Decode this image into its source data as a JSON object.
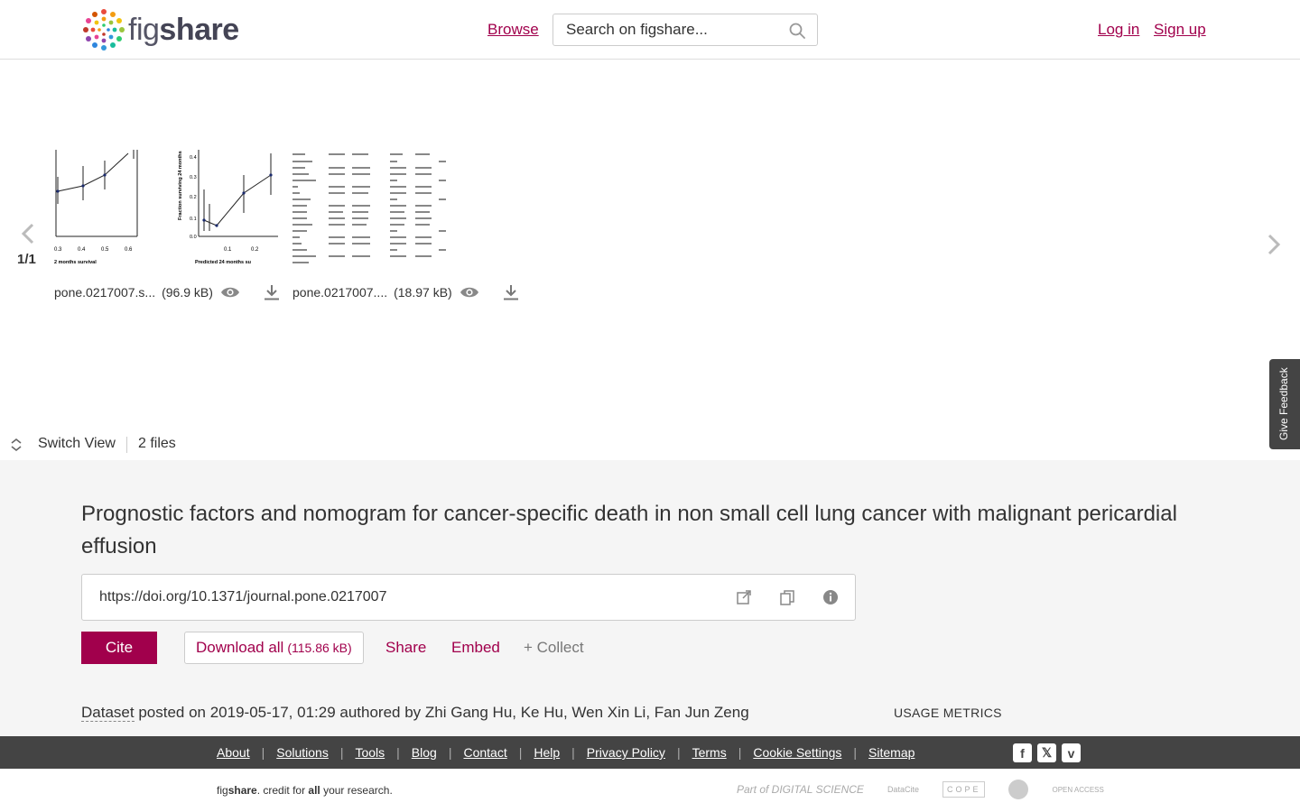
{
  "header": {
    "brand_light": "fig",
    "brand_bold": "share",
    "browse": "Browse",
    "search_placeholder": "Search on figshare...",
    "login": "Log in",
    "signup": "Sign up"
  },
  "carousel": {
    "page": "1/1",
    "files": [
      {
        "name": "pone.0217007.s...",
        "size": "(96.9 kB)"
      },
      {
        "name": "pone.0217007....",
        "size": "(18.97 kB)"
      }
    ]
  },
  "thumb1": {
    "xticks": [
      "0.3",
      "0.4",
      "0.5",
      "0.6"
    ],
    "xlabel": "2 months survival"
  },
  "thumb2": {
    "yticks": [
      "0.0",
      "0.1",
      "0.2",
      "0.3",
      "0.4"
    ],
    "xticks": [
      "0.1",
      "0.2"
    ],
    "ylabel": "Fraction surviving 24 months",
    "xlabel": "Predicted 24 months su"
  },
  "feedback": "Give Feedback",
  "switch_view": {
    "label": "Switch View",
    "files_count": "2 files"
  },
  "item": {
    "title": "Prognostic factors and nomogram for cancer-specific death in non small cell lung cancer with malignant pericardial effusion",
    "doi": "https://doi.org/10.1371/journal.pone.0217007",
    "cite": "Cite",
    "download_all": "Download all",
    "download_size": "(115.86 kB)",
    "share": "Share",
    "embed": "Embed",
    "collect": "+ Collect",
    "type": "Dataset",
    "posted_text": " posted on 2019-05-17, 01:29 authored by Zhi Gang Hu, Ke Hu, Wen Xin Li, Fan Jun Zeng",
    "usage_metrics": "USAGE METRICS"
  },
  "footer": {
    "links": [
      "About",
      "Solutions",
      "Tools",
      "Blog",
      "Contact",
      "Help",
      "Privacy Policy",
      "Terms",
      "Cookie Settings",
      "Sitemap"
    ],
    "credit_fig": "fig",
    "credit_share": "share",
    "credit_mid": ". credit for ",
    "credit_all": "all",
    "credit_end": " your research.",
    "partners": [
      "Part of DIGITAL SCIENCE",
      "DataCite",
      "COPE",
      "",
      "OPEN ACCESS"
    ]
  },
  "colors": {
    "accent": "#a1004c",
    "footer_bg": "#444444",
    "details_bg": "#f5f5f5"
  }
}
